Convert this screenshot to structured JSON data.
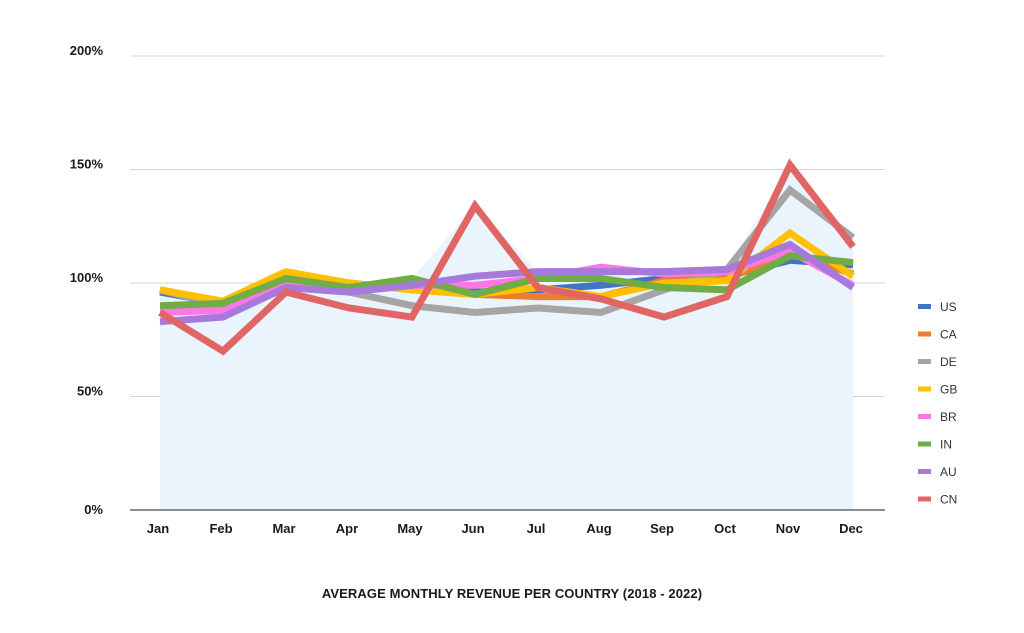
{
  "chart_data": {
    "type": "line",
    "title": "AVERAGE MONTHLY REVENUE PER COUNTRY (2018 - 2022)",
    "xlabel": "",
    "ylabel": "",
    "ylim": [
      0,
      200
    ],
    "y_ticks": [
      0,
      50,
      100,
      150,
      200
    ],
    "y_tick_labels": [
      "0%",
      "50%",
      "100%",
      "150%",
      "200%"
    ],
    "grid": true,
    "legend_position": "right",
    "area_fill": {
      "description": "max envelope of all series",
      "color": "#EAF4FD"
    },
    "categories": [
      "Jan",
      "Feb",
      "Mar",
      "Apr",
      "May",
      "Jun",
      "Jul",
      "Aug",
      "Sep",
      "Oct",
      "Nov",
      "Dec"
    ],
    "series": [
      {
        "name": "US",
        "color": "#4472C4",
        "values": [
          96,
          91,
          103,
          100,
          97,
          96,
          97,
          99,
          102,
          103,
          110,
          108
        ]
      },
      {
        "name": "CA",
        "color": "#ED7D31",
        "values": [
          97,
          91,
          104,
          100,
          97,
          95,
          94,
          94,
          101,
          102,
          113,
          104
        ]
      },
      {
        "name": "DE",
        "color": "#A5A5A5",
        "values": [
          97,
          90,
          100,
          96,
          90,
          87,
          89,
          87,
          97,
          106,
          141,
          120
        ]
      },
      {
        "name": "GB",
        "color": "#FFC000",
        "values": [
          97,
          92,
          105,
          100,
          97,
          95,
          98,
          94,
          100,
          101,
          122,
          103
        ]
      },
      {
        "name": "BR",
        "color": "#FF77E6",
        "values": [
          87,
          88,
          99,
          96,
          99,
          99,
          102,
          107,
          104,
          105,
          114,
          99
        ]
      },
      {
        "name": "IN",
        "color": "#70AD47",
        "values": [
          90,
          91,
          102,
          98,
          102,
          95,
          102,
          102,
          98,
          97,
          112,
          109
        ]
      },
      {
        "name": "AU",
        "color": "#A679DB",
        "values": [
          83,
          85,
          98,
          96,
          99,
          103,
          105,
          105,
          105,
          106,
          117,
          98
        ]
      },
      {
        "name": "CN",
        "color": "#E06666",
        "values": [
          87,
          70,
          96,
          89,
          85,
          134,
          98,
          93,
          85,
          94,
          152,
          116
        ]
      }
    ]
  }
}
